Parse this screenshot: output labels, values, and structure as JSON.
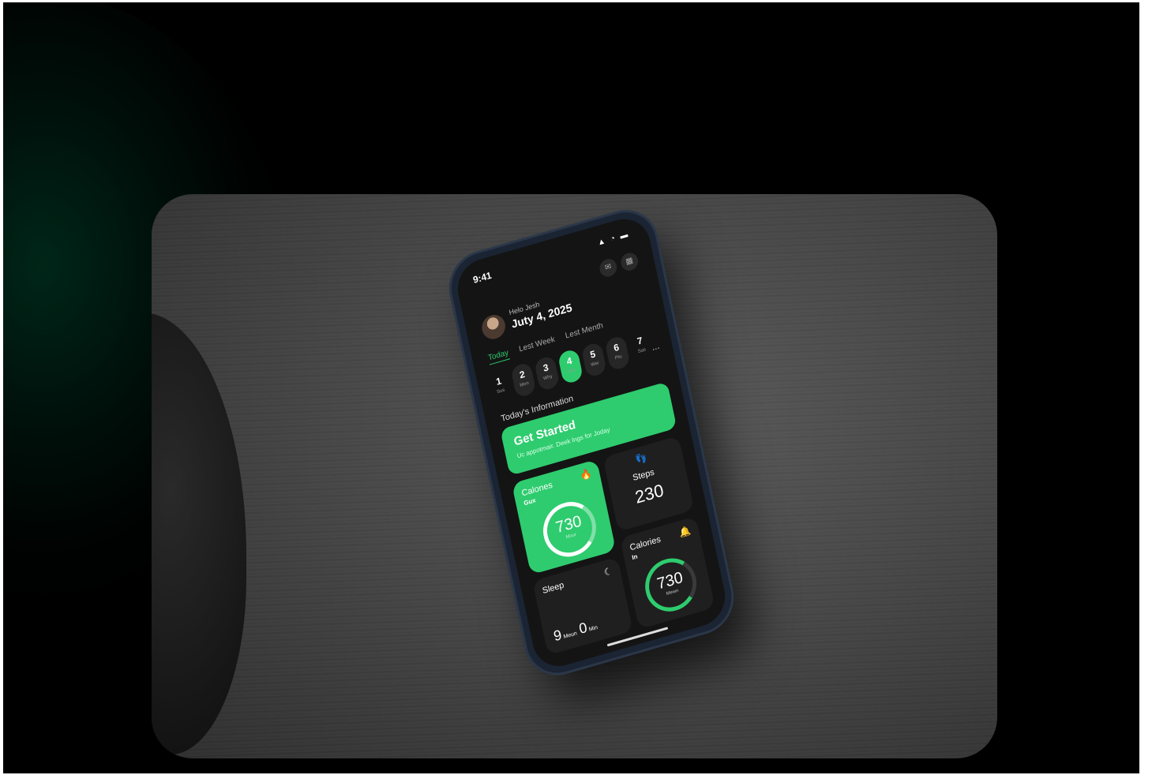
{
  "status": {
    "time": "9:41",
    "icons": "▲ ◔ ▬"
  },
  "header": {
    "greeting": "Helo Jesh",
    "date": "Juty 4, 2025"
  },
  "top_buttons": [
    "✉",
    "▦"
  ],
  "tabs": [
    {
      "label": "Today",
      "active": true
    },
    {
      "label": "Lest Week",
      "active": false
    },
    {
      "label": "Lest Menth",
      "active": false
    }
  ],
  "days": [
    {
      "num": "1",
      "wd": "Sus",
      "selected": false
    },
    {
      "num": "2",
      "wd": "Mon",
      "selected": false
    },
    {
      "num": "3",
      "wd": "Why",
      "selected": false
    },
    {
      "num": "4",
      "wd": "Ure",
      "selected": true
    },
    {
      "num": "5",
      "wd": "Wei",
      "selected": false
    },
    {
      "num": "6",
      "wd": "Ptu",
      "selected": false
    },
    {
      "num": "7",
      "wd": "Sas",
      "selected": false
    }
  ],
  "more": "...",
  "info_title": "Today's Information",
  "hero": {
    "title": "Get Started",
    "subtitle": "Uc appotmair. Deek lngs for Joday"
  },
  "calories_out": {
    "label": "Calones",
    "sub": "Gux",
    "value": "730",
    "unit": "Mour",
    "icon": "🔥"
  },
  "steps": {
    "label": "Steps",
    "value": "230",
    "icon": "👣"
  },
  "calories_in": {
    "label": "Calories",
    "sub": "In",
    "value": "730",
    "unit": "Mewn",
    "icon": "🔔"
  },
  "sleep": {
    "label": "Sleep",
    "icon": "☾",
    "hours": "9",
    "hours_unit": "Meun",
    "mins": "0",
    "mins_unit": "Min"
  },
  "colors": {
    "accent": "#2ecc6e",
    "tile": "#1f1f1f"
  }
}
